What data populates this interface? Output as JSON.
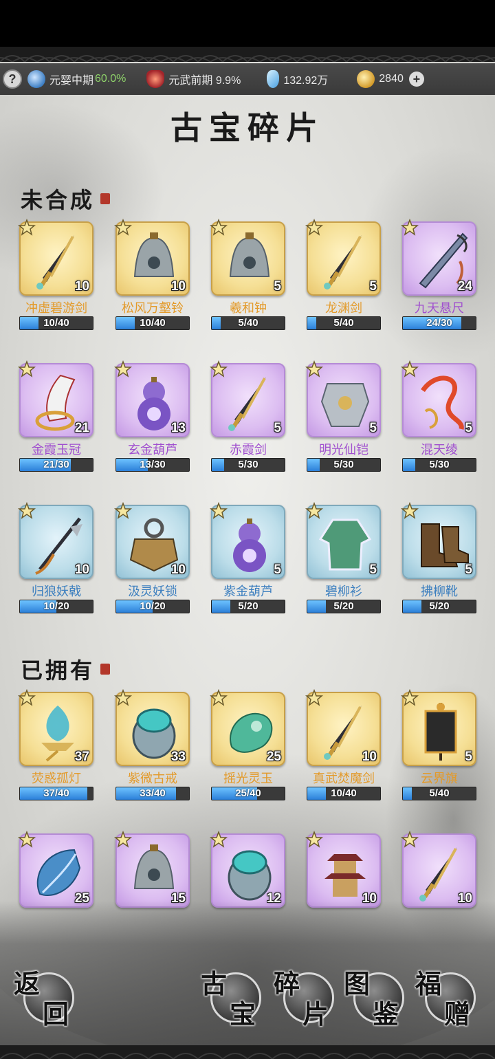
{
  "status_bar": {
    "realm": "元婴中期",
    "realm_progress": "60.0%",
    "martial": "元武前期 9.9%",
    "spirit_stones": "132.92万",
    "gold": "2840"
  },
  "title": "古宝碎片",
  "sections": {
    "unsynthesized": "未合成",
    "owned": "已拥有"
  },
  "unsynthesized_items": [
    {
      "name": "冲虚碧游剑",
      "count": "10",
      "progress": "10/40",
      "fraction": 0.25,
      "tier": "gold",
      "art": "sword"
    },
    {
      "name": "松风万壑铃",
      "count": "10",
      "progress": "10/40",
      "fraction": 0.25,
      "tier": "gold",
      "art": "bell"
    },
    {
      "name": "羲和钟",
      "count": "5",
      "progress": "5/40",
      "fraction": 0.125,
      "tier": "gold",
      "art": "bell"
    },
    {
      "name": "龙渊剑",
      "count": "5",
      "progress": "5/40",
      "fraction": 0.125,
      "tier": "gold",
      "art": "sword"
    },
    {
      "name": "九天悬尺",
      "count": "24",
      "progress": "24/30",
      "fraction": 0.8,
      "tier": "purple",
      "art": "ruler"
    },
    {
      "name": "金霞玉冠",
      "count": "21",
      "progress": "21/30",
      "fraction": 0.7,
      "tier": "purple",
      "art": "crown"
    },
    {
      "name": "玄金葫芦",
      "count": "13",
      "progress": "13/30",
      "fraction": 0.433,
      "tier": "purple",
      "art": "gourd"
    },
    {
      "name": "赤霞剑",
      "count": "5",
      "progress": "5/30",
      "fraction": 0.167,
      "tier": "purple",
      "art": "sword"
    },
    {
      "name": "明光仙铠",
      "count": "5",
      "progress": "5/30",
      "fraction": 0.167,
      "tier": "purple",
      "art": "armor"
    },
    {
      "name": "混天绫",
      "count": "5",
      "progress": "5/30",
      "fraction": 0.167,
      "tier": "purple",
      "art": "ribbon"
    },
    {
      "name": "归狼妖戟",
      "count": "10",
      "progress": "10/20",
      "fraction": 0.5,
      "tier": "blue",
      "art": "halberd"
    },
    {
      "name": "汲灵妖锁",
      "count": "10",
      "progress": "10/20",
      "fraction": 0.5,
      "tier": "blue",
      "art": "lock"
    },
    {
      "name": "紫金葫芦",
      "count": "5",
      "progress": "5/20",
      "fraction": 0.25,
      "tier": "blue",
      "art": "gourd"
    },
    {
      "name": "碧柳衫",
      "count": "5",
      "progress": "5/20",
      "fraction": 0.25,
      "tier": "blue",
      "art": "robe"
    },
    {
      "name": "拂柳靴",
      "count": "5",
      "progress": "5/20",
      "fraction": 0.25,
      "tier": "blue",
      "art": "boots"
    }
  ],
  "owned_items": [
    {
      "name": "荧惑孤灯",
      "count": "37",
      "progress": "37/40",
      "fraction": 0.925,
      "tier": "gold",
      "art": "lamp"
    },
    {
      "name": "紫微古戒",
      "count": "33",
      "progress": "33/40",
      "fraction": 0.825,
      "tier": "gold",
      "art": "ring"
    },
    {
      "name": "摇光灵玉",
      "count": "25",
      "progress": "25/40",
      "fraction": 0.625,
      "tier": "gold",
      "art": "jade"
    },
    {
      "name": "真武焚魔剑",
      "count": "10",
      "progress": "10/40",
      "fraction": 0.25,
      "tier": "gold",
      "art": "sword"
    },
    {
      "name": "云界旗",
      "count": "5",
      "progress": "5/40",
      "fraction": 0.125,
      "tier": "gold",
      "art": "banner"
    },
    {
      "name": "",
      "count": "25",
      "progress": "",
      "fraction": 0,
      "tier": "purple",
      "art": "feather"
    },
    {
      "name": "",
      "count": "15",
      "progress": "",
      "fraction": 0,
      "tier": "purple",
      "art": "bell"
    },
    {
      "name": "",
      "count": "12",
      "progress": "",
      "fraction": 0,
      "tier": "purple",
      "art": "ring"
    },
    {
      "name": "",
      "count": "10",
      "progress": "",
      "fraction": 0,
      "tier": "purple",
      "art": "pagoda"
    },
    {
      "name": "",
      "count": "10",
      "progress": "",
      "fraction": 0,
      "tier": "purple",
      "art": "sword"
    }
  ],
  "buttons": {
    "back": [
      "返",
      "回"
    ],
    "treasure": [
      "古",
      "宝"
    ],
    "fragments": [
      "碎",
      "片"
    ],
    "codex": [
      "图",
      "鉴"
    ],
    "gift": [
      "福",
      "赠"
    ]
  },
  "colors": {
    "gold_name": "#e39a2a",
    "purple_name": "#a04fcf",
    "blue_name": "#3c7fbf",
    "progress_fill": "#2b7fd8",
    "realm_highlight": "#8fd36a"
  }
}
